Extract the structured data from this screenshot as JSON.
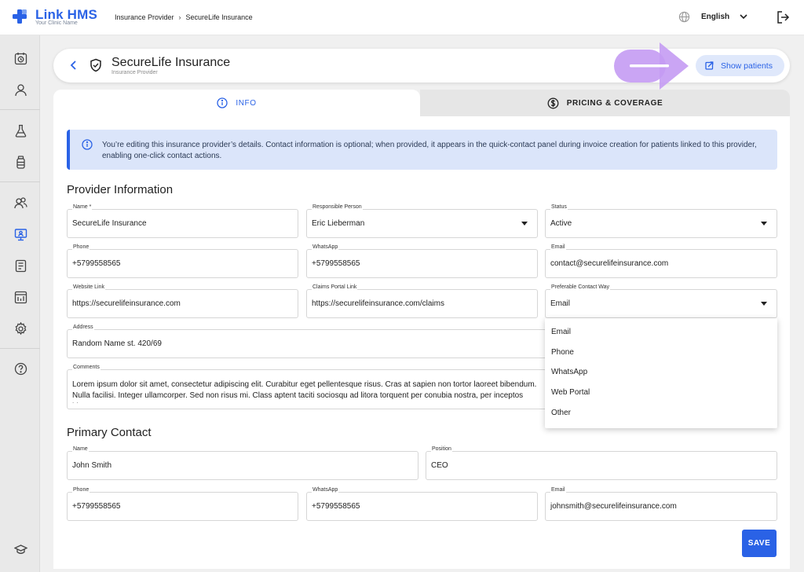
{
  "app": {
    "title": "Link HMS",
    "subtitle": "Your Clinic Name",
    "brand_color": "#2a62e6"
  },
  "breadcrumb": [
    "Insurance Provider",
    "SecureLife Insurance"
  ],
  "topbar": {
    "language": "English"
  },
  "sidebar": {
    "items": [
      {
        "icon": "calendar-clock-icon"
      },
      {
        "icon": "user-icon"
      },
      {
        "icon": "flask-icon"
      },
      {
        "icon": "bottle-icon"
      },
      {
        "icon": "users-icon"
      },
      {
        "icon": "monitor-user-icon"
      },
      {
        "icon": "document-list-icon"
      },
      {
        "icon": "report-icon"
      },
      {
        "icon": "settings-icon"
      },
      {
        "icon": "help-icon"
      },
      {
        "icon": "graduation-cap-icon"
      }
    ],
    "active_index": 5
  },
  "header": {
    "title": "SecureLife Insurance",
    "subtitle": "Insurance Provider",
    "show_patients_label": "Show patients"
  },
  "tabs": [
    {
      "label": "INFO",
      "active": true
    },
    {
      "label": "PRICING & COVERAGE",
      "active": false
    }
  ],
  "alert": {
    "text": "You’re editing this insurance provider’s details. Contact information is optional; when provided, it appears in the quick-contact panel during invoice creation for patients linked to this provider, enabling one-click contact actions."
  },
  "provider": {
    "section_title": "Provider Information",
    "name": {
      "label": "Name *",
      "value": "SecureLife Insurance"
    },
    "responsible_person": {
      "label": "Responsible Person",
      "value": "Eric Lieberman"
    },
    "status": {
      "label": "Status",
      "value": "Active"
    },
    "phone": {
      "label": "Phone",
      "value": "+5799558565"
    },
    "whatsapp": {
      "label": "WhatsApp",
      "value": "+5799558565"
    },
    "email": {
      "label": "Email",
      "value": "contact@securelifeinsurance.com"
    },
    "website": {
      "label": "Website Link",
      "value": "https://securelifeinsurance.com"
    },
    "claims_portal": {
      "label": "Claims Portal Link",
      "value": "https://securelifeinsurance.com/claims"
    },
    "preferable_contact": {
      "label": "Preferable Contact Way",
      "value": "Email"
    },
    "address": {
      "label": "Address",
      "value": "Random Name st. 420/69"
    },
    "comments": {
      "label": "Comments",
      "value": "Lorem ipsum dolor sit amet, consectetur adipiscing elit. Curabitur eget pellentesque risus. Cras at sapien non tortor laoreet bibendum. Nulla facilisi. Integer ullamcorper. Sed non risus mi. Class aptent taciti sociosqu ad litora torquent per conubia nostra, per inceptos himenaeos."
    }
  },
  "contact_options": [
    "Email",
    "Phone",
    "WhatsApp",
    "Web Portal",
    "Other"
  ],
  "primary_contact": {
    "section_title": "Primary Contact",
    "name": {
      "label": "Name",
      "value": "John Smith"
    },
    "position": {
      "label": "Position",
      "value": "CEO"
    },
    "phone": {
      "label": "Phone",
      "value": "+5799558565"
    },
    "whatsapp": {
      "label": "WhatsApp",
      "value": "+5799558565"
    },
    "email": {
      "label": "Email",
      "value": "johnsmith@securelifeinsurance.com"
    }
  },
  "actions": {
    "save_label": "SAVE"
  }
}
